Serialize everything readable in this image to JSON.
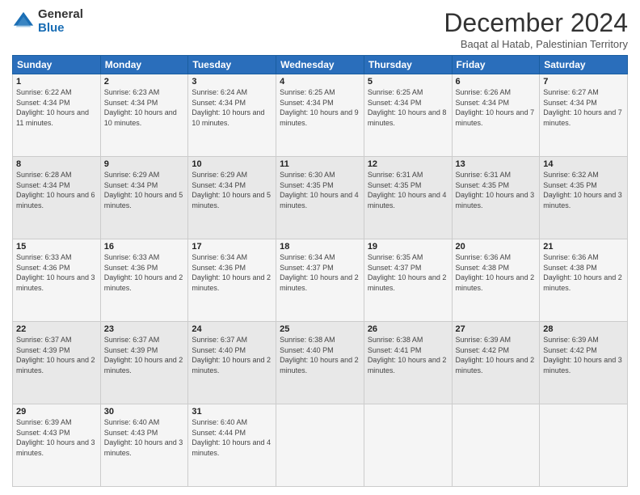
{
  "header": {
    "logo": {
      "general": "General",
      "blue": "Blue"
    },
    "title": "December 2024",
    "location": "Baqat al Hatab, Palestinian Territory"
  },
  "calendar": {
    "days_of_week": [
      "Sunday",
      "Monday",
      "Tuesday",
      "Wednesday",
      "Thursday",
      "Friday",
      "Saturday"
    ],
    "weeks": [
      [
        {
          "day": "1",
          "sunrise": "6:22 AM",
          "sunset": "4:34 PM",
          "daylight": "10 hours and 11 minutes."
        },
        {
          "day": "2",
          "sunrise": "6:23 AM",
          "sunset": "4:34 PM",
          "daylight": "10 hours and 10 minutes."
        },
        {
          "day": "3",
          "sunrise": "6:24 AM",
          "sunset": "4:34 PM",
          "daylight": "10 hours and 10 minutes."
        },
        {
          "day": "4",
          "sunrise": "6:25 AM",
          "sunset": "4:34 PM",
          "daylight": "10 hours and 9 minutes."
        },
        {
          "day": "5",
          "sunrise": "6:25 AM",
          "sunset": "4:34 PM",
          "daylight": "10 hours and 8 minutes."
        },
        {
          "day": "6",
          "sunrise": "6:26 AM",
          "sunset": "4:34 PM",
          "daylight": "10 hours and 7 minutes."
        },
        {
          "day": "7",
          "sunrise": "6:27 AM",
          "sunset": "4:34 PM",
          "daylight": "10 hours and 7 minutes."
        }
      ],
      [
        {
          "day": "8",
          "sunrise": "6:28 AM",
          "sunset": "4:34 PM",
          "daylight": "10 hours and 6 minutes."
        },
        {
          "day": "9",
          "sunrise": "6:29 AM",
          "sunset": "4:34 PM",
          "daylight": "10 hours and 5 minutes."
        },
        {
          "day": "10",
          "sunrise": "6:29 AM",
          "sunset": "4:34 PM",
          "daylight": "10 hours and 5 minutes."
        },
        {
          "day": "11",
          "sunrise": "6:30 AM",
          "sunset": "4:35 PM",
          "daylight": "10 hours and 4 minutes."
        },
        {
          "day": "12",
          "sunrise": "6:31 AM",
          "sunset": "4:35 PM",
          "daylight": "10 hours and 4 minutes."
        },
        {
          "day": "13",
          "sunrise": "6:31 AM",
          "sunset": "4:35 PM",
          "daylight": "10 hours and 3 minutes."
        },
        {
          "day": "14",
          "sunrise": "6:32 AM",
          "sunset": "4:35 PM",
          "daylight": "10 hours and 3 minutes."
        }
      ],
      [
        {
          "day": "15",
          "sunrise": "6:33 AM",
          "sunset": "4:36 PM",
          "daylight": "10 hours and 3 minutes."
        },
        {
          "day": "16",
          "sunrise": "6:33 AM",
          "sunset": "4:36 PM",
          "daylight": "10 hours and 2 minutes."
        },
        {
          "day": "17",
          "sunrise": "6:34 AM",
          "sunset": "4:36 PM",
          "daylight": "10 hours and 2 minutes."
        },
        {
          "day": "18",
          "sunrise": "6:34 AM",
          "sunset": "4:37 PM",
          "daylight": "10 hours and 2 minutes."
        },
        {
          "day": "19",
          "sunrise": "6:35 AM",
          "sunset": "4:37 PM",
          "daylight": "10 hours and 2 minutes."
        },
        {
          "day": "20",
          "sunrise": "6:36 AM",
          "sunset": "4:38 PM",
          "daylight": "10 hours and 2 minutes."
        },
        {
          "day": "21",
          "sunrise": "6:36 AM",
          "sunset": "4:38 PM",
          "daylight": "10 hours and 2 minutes."
        }
      ],
      [
        {
          "day": "22",
          "sunrise": "6:37 AM",
          "sunset": "4:39 PM",
          "daylight": "10 hours and 2 minutes."
        },
        {
          "day": "23",
          "sunrise": "6:37 AM",
          "sunset": "4:39 PM",
          "daylight": "10 hours and 2 minutes."
        },
        {
          "day": "24",
          "sunrise": "6:37 AM",
          "sunset": "4:40 PM",
          "daylight": "10 hours and 2 minutes."
        },
        {
          "day": "25",
          "sunrise": "6:38 AM",
          "sunset": "4:40 PM",
          "daylight": "10 hours and 2 minutes."
        },
        {
          "day": "26",
          "sunrise": "6:38 AM",
          "sunset": "4:41 PM",
          "daylight": "10 hours and 2 minutes."
        },
        {
          "day": "27",
          "sunrise": "6:39 AM",
          "sunset": "4:42 PM",
          "daylight": "10 hours and 2 minutes."
        },
        {
          "day": "28",
          "sunrise": "6:39 AM",
          "sunset": "4:42 PM",
          "daylight": "10 hours and 3 minutes."
        }
      ],
      [
        {
          "day": "29",
          "sunrise": "6:39 AM",
          "sunset": "4:43 PM",
          "daylight": "10 hours and 3 minutes."
        },
        {
          "day": "30",
          "sunrise": "6:40 AM",
          "sunset": "4:43 PM",
          "daylight": "10 hours and 3 minutes."
        },
        {
          "day": "31",
          "sunrise": "6:40 AM",
          "sunset": "4:44 PM",
          "daylight": "10 hours and 4 minutes."
        },
        null,
        null,
        null,
        null
      ]
    ]
  }
}
